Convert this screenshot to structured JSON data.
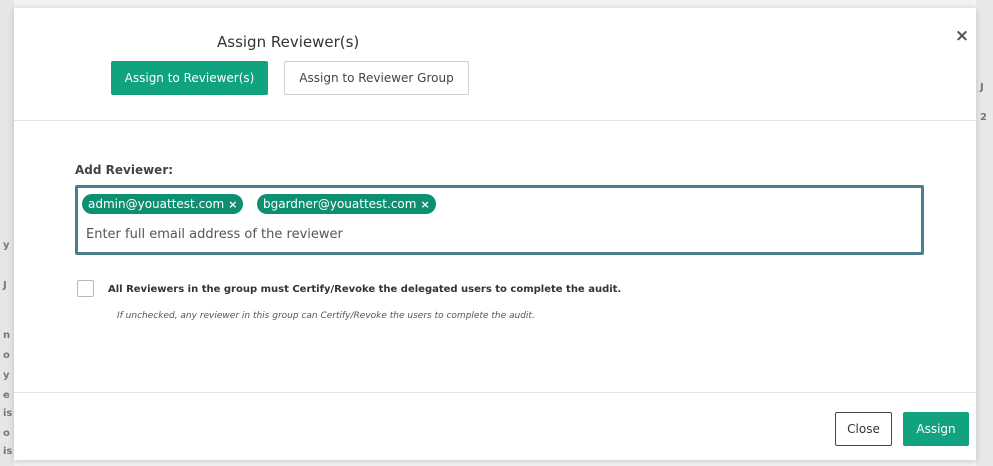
{
  "dialog": {
    "title": "Assign Reviewer(s)",
    "close_glyph": "×",
    "tabs": [
      {
        "label": "Assign to Reviewer(s)",
        "active": true
      },
      {
        "label": "Assign to Reviewer Group",
        "active": false
      }
    ]
  },
  "form": {
    "add_reviewer_label": "Add Reviewer:",
    "reviewers": [
      {
        "email": "admin@youattest.com"
      },
      {
        "email": "bgardner@youattest.com"
      }
    ],
    "chip_remove_glyph": "×",
    "input_placeholder": "Enter full email address of the reviewer",
    "input_value": "",
    "certify_all_checked": false,
    "certify_all_label": "All Reviewers in the group must Certify/Revoke the delegated users to complete the audit.",
    "certify_all_help": "If unchecked, any reviewer in this group can Certify/Revoke the users to complete the audit."
  },
  "footer": {
    "close_label": "Close",
    "assign_label": "Assign"
  },
  "background": {
    "left_glyphs": [
      "y",
      "J",
      "n",
      "o",
      "y",
      "e",
      "is",
      "o",
      "is"
    ],
    "right_glyphs": [
      "J",
      "2"
    ]
  },
  "colors": {
    "accent": "#11a37f",
    "chip": "#0f8f72",
    "input_focus_border": "#4a7e8f"
  }
}
